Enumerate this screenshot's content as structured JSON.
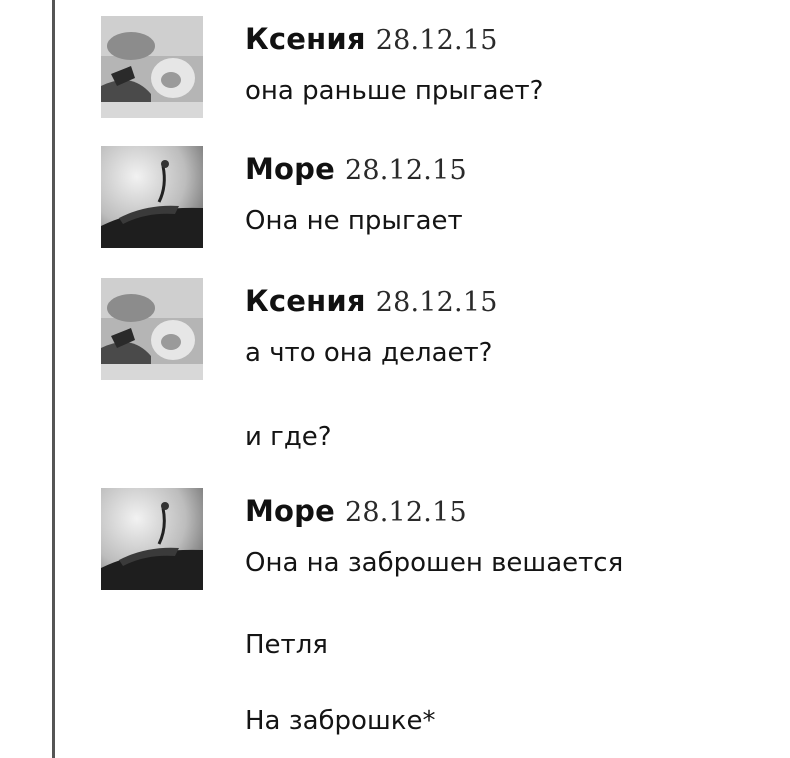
{
  "messages": [
    {
      "author": "Ксения",
      "date": "28.12.15",
      "avatar_icon": "user-photo-icon",
      "lines": [
        "она раньше прыгает?"
      ]
    },
    {
      "author": "Море",
      "date": "28.12.15",
      "avatar_icon": "user-photo-icon",
      "lines": [
        "Она не прыгает"
      ]
    },
    {
      "author": "Ксения",
      "date": "28.12.15",
      "avatar_icon": "user-photo-icon",
      "lines": [
        "а что она делает?",
        "и где?"
      ]
    },
    {
      "author": "Море",
      "date": "28.12.15",
      "avatar_icon": "user-photo-icon",
      "lines": [
        "Она на заброшен вешается",
        "Петля",
        "На заброшке*"
      ]
    }
  ],
  "colors": {
    "text": "#141414",
    "rule": "#555555"
  }
}
